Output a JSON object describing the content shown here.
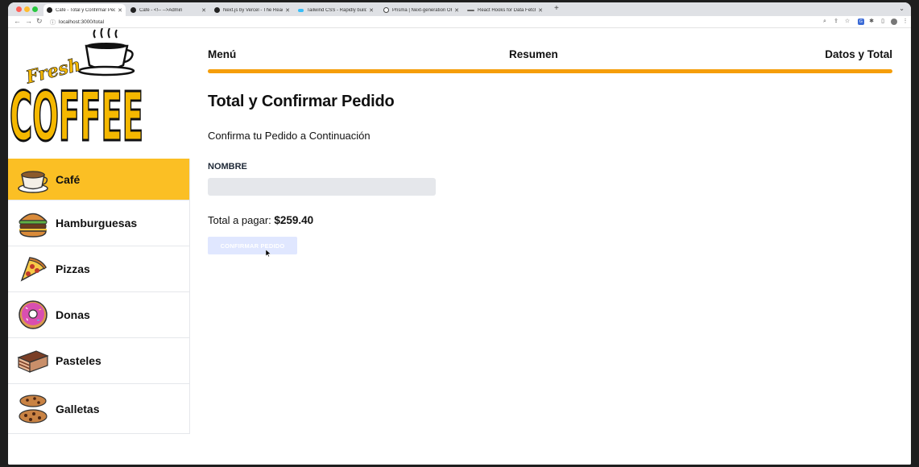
{
  "browser": {
    "tabs": [
      {
        "title": "Café - Total y Confirmar Pedido",
        "active": true,
        "favicon": "nextjs-icon"
      },
      {
        "title": "Café - <!-- -->Admin",
        "active": false,
        "favicon": "nextjs-icon"
      },
      {
        "title": "Next.js by Vercel - The React F",
        "active": false,
        "favicon": "nextjs-icon"
      },
      {
        "title": "Tailwind CSS - Rapidly build m",
        "active": false,
        "favicon": "tailwind-icon"
      },
      {
        "title": "Prisma | Next-generation ORM",
        "active": false,
        "favicon": "prisma-icon"
      },
      {
        "title": "React Hooks for Data Fetching",
        "active": false,
        "favicon": "swr-icon"
      }
    ],
    "url": "localhost:3000/total"
  },
  "colors": {
    "accent": "#f59e0b",
    "active_category": "#fbbf24",
    "input_bg": "#e5e7eb",
    "button_disabled": "#e0e7ff"
  },
  "sidebar": {
    "logo_text_top": "Fresh",
    "logo_text_main": "COFFEE",
    "categories": [
      {
        "label": "Café",
        "icon": "coffee-cup-icon",
        "active": true
      },
      {
        "label": "Hamburguesas",
        "icon": "hamburger-icon",
        "active": false
      },
      {
        "label": "Pizzas",
        "icon": "pizza-icon",
        "active": false
      },
      {
        "label": "Donas",
        "icon": "donut-icon",
        "active": false
      },
      {
        "label": "Pasteles",
        "icon": "cake-icon",
        "active": false
      },
      {
        "label": "Galletas",
        "icon": "cookies-icon",
        "active": false
      }
    ]
  },
  "steps": {
    "items": [
      "Menú",
      "Resumen",
      "Datos y Total"
    ],
    "progress": 1.0
  },
  "main": {
    "title": "Total y Confirmar Pedido",
    "subtitle": "Confirma tu Pedido a Continuación",
    "name_label": "NOMBRE",
    "name_value": "",
    "total_label": "Total a pagar: ",
    "total_value": "$259.40",
    "confirm_button": "CONFIRMAR PEDIDO"
  }
}
